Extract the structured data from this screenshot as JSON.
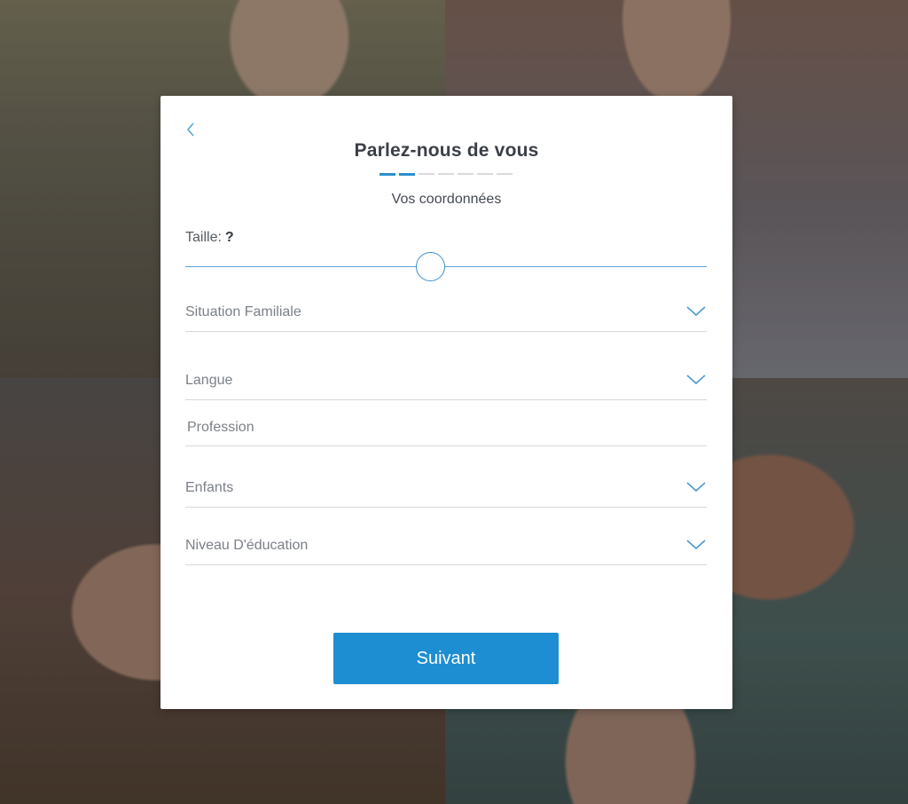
{
  "modal": {
    "title": "Parlez-nous de vous",
    "subtitle": "Vos coordonnées",
    "progress": {
      "total_steps": 7,
      "current_step": 2
    }
  },
  "height": {
    "label": "Taille:",
    "value": "?",
    "slider_level": 0.47
  },
  "fields": {
    "marital_status": {
      "label": "Situation Familiale"
    },
    "language": {
      "label": "Langue"
    },
    "profession": {
      "placeholder": "Profession",
      "value": ""
    },
    "children": {
      "label": "Enfants"
    },
    "education": {
      "label": "Niveau D'éducation"
    }
  },
  "icons": {
    "back": "chevron-left-icon",
    "dropdown": "chevron-down-icon"
  },
  "colors": {
    "accent": "#1e8ed3",
    "slider": "#3d8fca",
    "title_text": "#3a3f47",
    "field_text": "#7b8087"
  },
  "actions": {
    "next_label": "Suivant"
  }
}
